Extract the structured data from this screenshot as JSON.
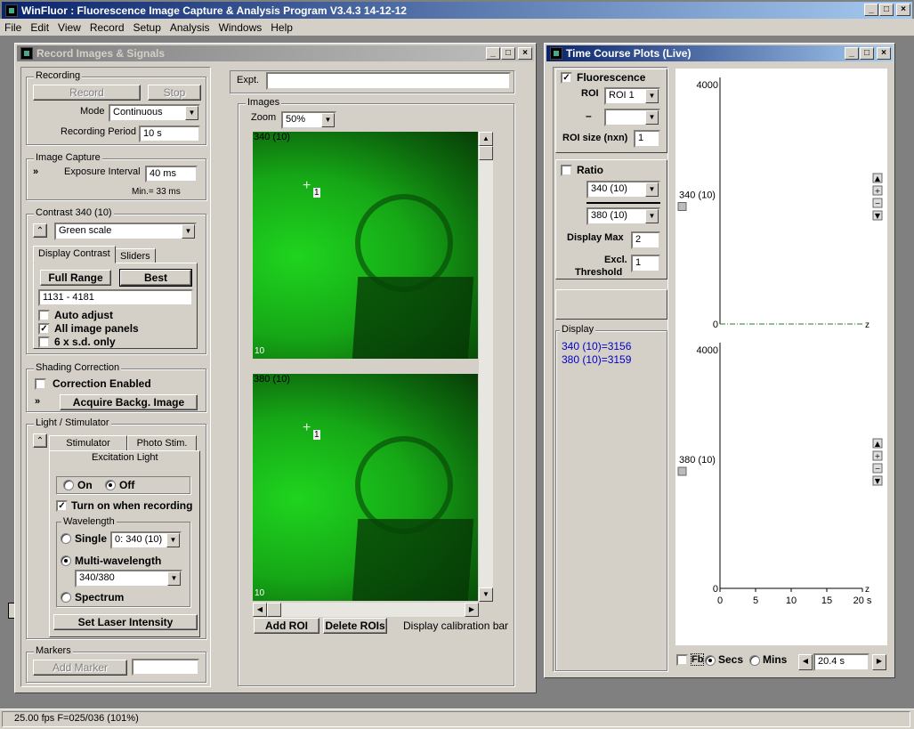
{
  "app": {
    "title": "WinFluor : Fluorescence Image Capture & Analysis Program V3.4.3 14-12-12"
  },
  "menu": [
    "File",
    "Edit",
    "View",
    "Record",
    "Setup",
    "Analysis",
    "Windows",
    "Help"
  ],
  "record_window": {
    "title": "Record Images & Signals",
    "recording": {
      "group": "Recording",
      "record": "Record",
      "stop": "Stop",
      "mode_label": "Mode",
      "mode_value": "Continuous",
      "period_label": "Recording Period",
      "period_value": "10 s"
    },
    "capture": {
      "group": "Image Capture",
      "exposure_label": "Exposure Interval",
      "exposure_value": "40 ms",
      "min_text": "Min.= 33 ms"
    },
    "contrast": {
      "group": "Contrast 340 (10)",
      "palette": "Green scale",
      "tab1": "Display Contrast",
      "tab2": "Sliders",
      "full_range": "Full Range",
      "best": "Best",
      "range_value": "1131 - 4181",
      "auto_adjust": "Auto adjust",
      "all_panels": "All image panels",
      "sd_only": "6 x s.d. only"
    },
    "shading": {
      "group": "Shading Correction",
      "enabled": "Correction Enabled",
      "acquire": "Acquire Backg. Image"
    },
    "light": {
      "group": "Light / Stimulator",
      "tab1": "Stimulator",
      "tab2": "Photo Stim.",
      "excitation": "Excitation Light",
      "on": "On",
      "off": "Off",
      "turn_on": "Turn on when recording",
      "wavelength": "Wavelength",
      "single": "Single",
      "single_value": "0: 340 (10)",
      "multi": "Multi-wavelength",
      "multi_value": "340/380",
      "spectrum": "Spectrum",
      "laser": "Set Laser Intensity"
    },
    "markers": {
      "group": "Markers",
      "add": "Add Marker"
    },
    "expt_label": "Expt.",
    "images": {
      "group": "Images",
      "zoom_label": "Zoom",
      "zoom_value": "50%",
      "panel1": "340 (10)",
      "panel2": "380 (10)",
      "roi_num": "1",
      "scale": "10",
      "add_roi": "Add ROI",
      "delete_rois": "Delete ROIs",
      "calib": "Display calibration bar"
    }
  },
  "plot_window": {
    "title": "Time Course Plots (Live)",
    "fluorescence": "Fluorescence",
    "roi_label": "ROI",
    "roi_value": "ROI 1",
    "minus": "–",
    "roi_size_label": "ROI size (nxn)",
    "roi_size_value": "1",
    "ratio": "Ratio",
    "ratio_num": "340 (10)",
    "ratio_den": "380 (10)",
    "display_max_label": "Display Max",
    "display_max_value": "2",
    "excl_label1": "Excl.",
    "excl_label2": "Threshold",
    "excl_value": "1",
    "display_group": "Display",
    "readout1": "340 (10)=3156",
    "readout2": "380 (10)=3159",
    "fb": "Fb",
    "secs": "Secs",
    "mins": "Mins",
    "time_value": "20.4 s"
  },
  "chart_data": [
    {
      "type": "line",
      "series": [
        {
          "name": "340 (10)",
          "values": [
            0,
            0
          ]
        }
      ],
      "x": [
        0,
        20
      ],
      "ylim": [
        0,
        4000
      ],
      "yticks": [
        "4000",
        "0"
      ],
      "xlim": [
        0,
        20
      ],
      "end_label": "z"
    },
    {
      "type": "line",
      "series": [
        {
          "name": "380 (10)",
          "values": [
            0,
            0
          ]
        }
      ],
      "x": [
        0,
        20
      ],
      "ylim": [
        0,
        4000
      ],
      "yticks": [
        "4000",
        "0"
      ],
      "xlim": [
        0,
        20
      ],
      "xticks": [
        "0",
        "5",
        "10",
        "15",
        "20 s"
      ],
      "end_label": "z"
    }
  ],
  "status": "25.00 fps F=025/036 (101%)",
  "colors": {
    "title_active": "#0a246a",
    "readout": "#0000c8",
    "image_green": "#16a816"
  }
}
